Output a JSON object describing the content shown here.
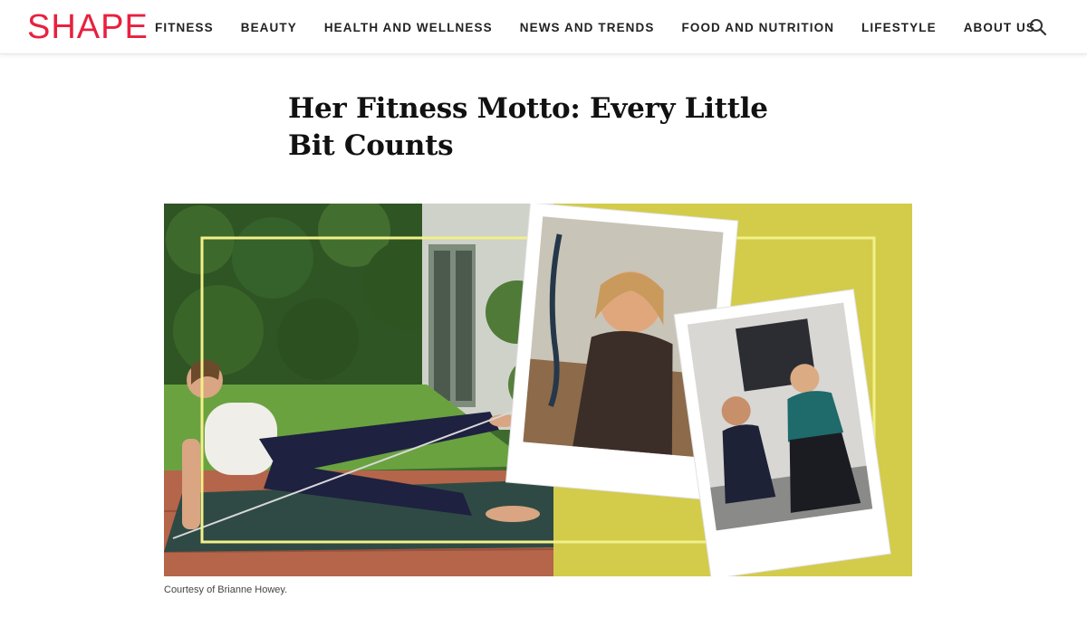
{
  "brand": {
    "logo_text": "SHAPE",
    "accent_color": "#e8203f"
  },
  "nav": {
    "items": [
      {
        "label": "FITNESS"
      },
      {
        "label": "BEAUTY"
      },
      {
        "label": "HEALTH AND WELLNESS"
      },
      {
        "label": "NEWS AND TRENDS"
      },
      {
        "label": "FOOD AND NUTRITION"
      },
      {
        "label": "LIFESTYLE"
      },
      {
        "label": "ABOUT US"
      }
    ],
    "search_icon": "search-icon"
  },
  "article": {
    "headline": "Her Fitness Motto: Every Little Bit Counts",
    "image_caption": "Courtesy of Brianne Howey.",
    "hero_background_color": "#d3cb4a",
    "frame_line_color": "#f2f08a"
  }
}
